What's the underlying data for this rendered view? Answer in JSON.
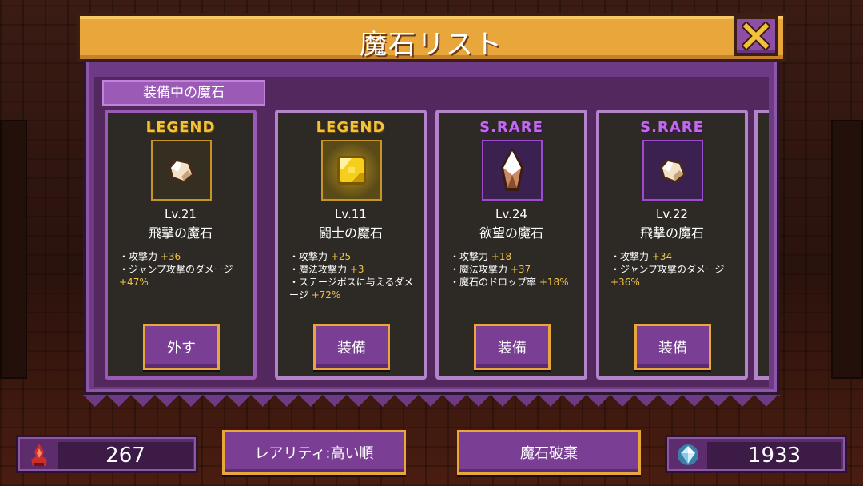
{
  "title": "魔石リスト",
  "equipped_tab_label": "装備中の魔石",
  "cards": [
    {
      "rarity": "LEGEND",
      "level": "Lv.21",
      "name": "飛撃の魔石",
      "stats": [
        {
          "label": "・攻撃力",
          "value": "+36"
        },
        {
          "label": "・ジャンプ攻撃のダメージ",
          "value": "+47%"
        }
      ],
      "action_label": "外す",
      "icon": "pale-crystal-icon"
    },
    {
      "rarity": "LEGEND",
      "level": "Lv.11",
      "name": "闘士の魔石",
      "stats": [
        {
          "label": "・攻撃力",
          "value": "+25"
        },
        {
          "label": "・魔法攻撃力",
          "value": "+3"
        },
        {
          "label": "・ステージボスに与えるダメージ",
          "value": "+72%"
        }
      ],
      "action_label": "装備",
      "icon": "golden-gem-icon"
    },
    {
      "rarity": "S.RARE",
      "level": "Lv.24",
      "name": "欲望の魔石",
      "stats": [
        {
          "label": "・攻撃力",
          "value": "+18"
        },
        {
          "label": "・魔法攻撃力",
          "value": "+37"
        },
        {
          "label": "・魔石のドロップ率",
          "value": "+18%"
        }
      ],
      "action_label": "装備",
      "icon": "shard-crystal-icon"
    },
    {
      "rarity": "S.RARE",
      "level": "Lv.22",
      "name": "飛撃の魔石",
      "stats": [
        {
          "label": "・攻撃力",
          "value": "+34"
        },
        {
          "label": "・ジャンプ攻撃のダメージ",
          "value": "+36%"
        }
      ],
      "action_label": "装備",
      "icon": "pale-crystal-icon"
    }
  ],
  "footer": {
    "left_count": "267",
    "sort_label": "レアリティ:高い順",
    "discard_label": "魔石破棄",
    "right_count": "1933"
  },
  "colors": {
    "legend": "#f3c13a",
    "s_rare": "#c368f0",
    "panel": "#6e3a86",
    "title_bar": "#e9a63a"
  }
}
